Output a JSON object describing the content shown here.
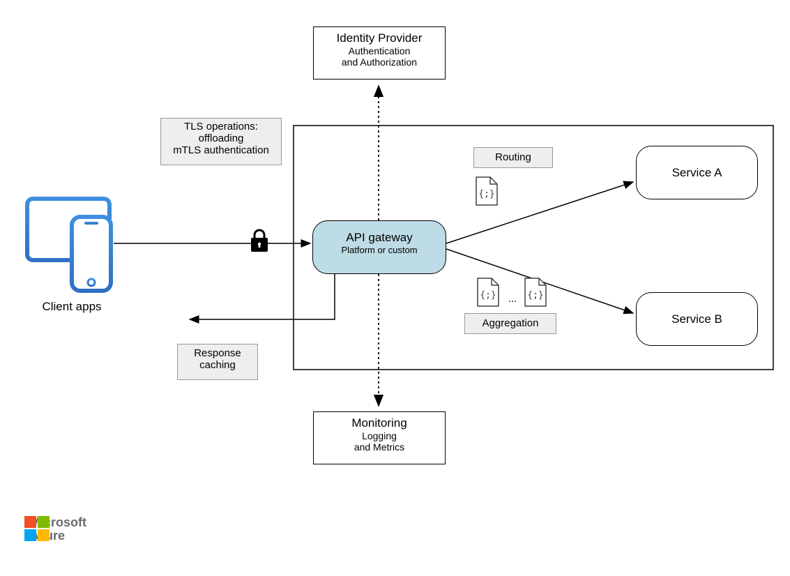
{
  "identityProvider": {
    "title": "Identity Provider",
    "sub1": "Authentication",
    "sub2": "and Authorization"
  },
  "tls": {
    "l1": "TLS operations:",
    "l2": "offloading",
    "l3": "mTLS authentication"
  },
  "routing": {
    "label": "Routing"
  },
  "aggregation": {
    "label": "Aggregation",
    "dots": "..."
  },
  "serviceA": {
    "label": "Service A"
  },
  "serviceB": {
    "label": "Service B"
  },
  "apiGateway": {
    "title": "API gateway",
    "sub": "Platform or custom"
  },
  "clientApps": {
    "label": "Client apps"
  },
  "responseCaching": {
    "l1": "Response",
    "l2": "caching"
  },
  "monitoring": {
    "title": "Monitoring",
    "sub1": "Logging",
    "sub2": "and Metrics"
  },
  "footer": {
    "brand1": "Microsoft",
    "brand2": "Azure"
  }
}
